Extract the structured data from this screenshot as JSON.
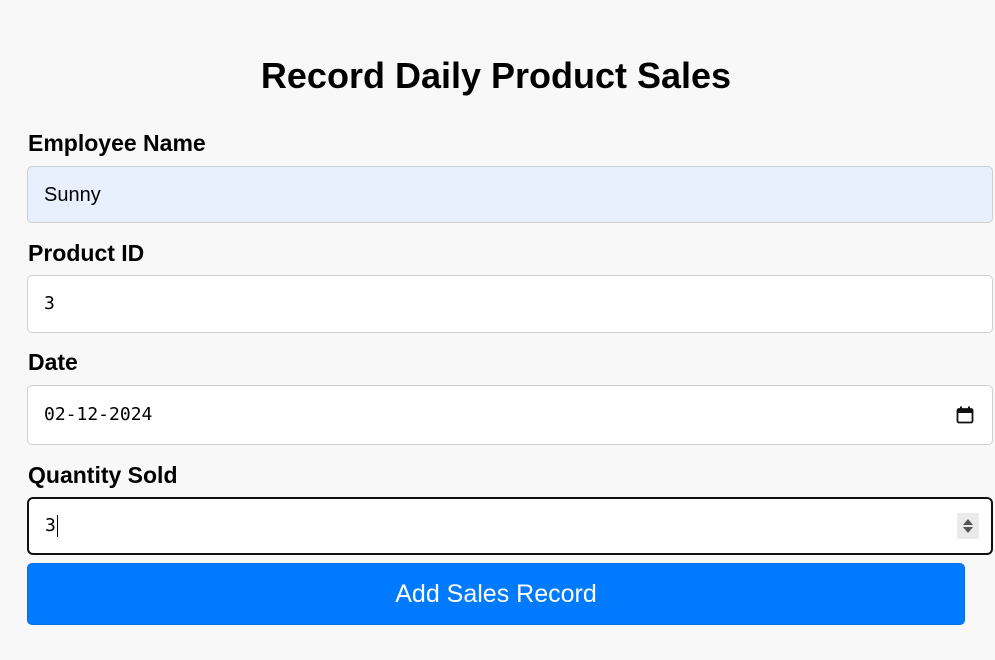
{
  "form": {
    "title": "Record Daily Product Sales",
    "fields": {
      "employee_name": {
        "label": "Employee Name",
        "value": "Sunny"
      },
      "product_id": {
        "label": "Product ID",
        "value": "3"
      },
      "date": {
        "label": "Date",
        "value": "02-12-2024"
      },
      "quantity_sold": {
        "label": "Quantity Sold",
        "value": "3"
      }
    },
    "submit_label": "Add Sales Record"
  },
  "icons": {
    "date_picker": "calendar-icon",
    "number_spinner": "spinner-arrows-icon"
  },
  "colors": {
    "page_background": "#f8f8f8",
    "button_background": "#007bff",
    "button_text": "#ffffff",
    "autofill_background": "#e8f0fe",
    "focus_border": "#101010"
  }
}
